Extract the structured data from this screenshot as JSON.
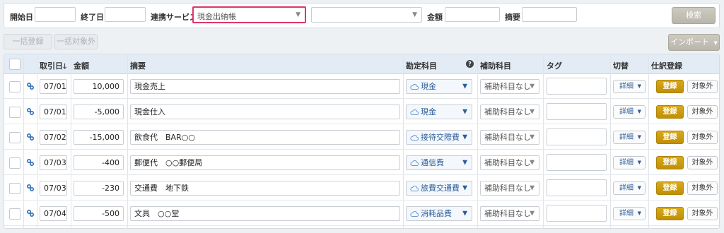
{
  "filters": {
    "start_date_label": "開始日",
    "start_date_value": "",
    "end_date_label": "終了日",
    "end_date_value": "",
    "service_label": "連携サービス",
    "service_selected": "現金出納帳",
    "service_sub_selected": "",
    "amount_label": "金額",
    "amount_value": "",
    "memo_label": "摘要",
    "memo_value": "",
    "search_button": "検索"
  },
  "actions": {
    "bulk_register": "一括登録",
    "bulk_exclude": "一括対象外",
    "import_button": "インポート"
  },
  "table": {
    "headers": {
      "date": "取引日",
      "sort_indicator": "🡓",
      "amount": "金額",
      "memo": "摘要",
      "account": "勘定科目",
      "help": "?",
      "sub_account": "補助科目",
      "tag": "タグ",
      "switch": "切替",
      "journal": "仕訳登録"
    },
    "detail_label": "詳細",
    "register_label": "登録",
    "exclude_label": "対象外",
    "rows": [
      {
        "date": "07/01",
        "amount": "10,000",
        "memo": "現金売上",
        "account": "現金",
        "sub_account": "補助科目なし",
        "tag": ""
      },
      {
        "date": "07/01",
        "amount": "-5,000",
        "memo": "現金仕入",
        "account": "現金",
        "sub_account": "補助科目なし",
        "tag": ""
      },
      {
        "date": "07/02",
        "amount": "-15,000",
        "memo": "飲食代　BAR○○",
        "account": "接待交際費",
        "sub_account": "補助科目なし",
        "tag": ""
      },
      {
        "date": "07/03",
        "amount": "-400",
        "memo": "郵便代　○○郵便局",
        "account": "通信費",
        "sub_account": "補助科目なし",
        "tag": ""
      },
      {
        "date": "07/03",
        "amount": "-230",
        "memo": "交通費　地下鉄",
        "account": "旅費交通費",
        "sub_account": "補助科目なし",
        "tag": ""
      },
      {
        "date": "07/04",
        "amount": "-500",
        "memo": "文具　○○堂",
        "account": "消耗品費",
        "sub_account": "補助科目なし",
        "tag": ""
      }
    ]
  },
  "colors": {
    "highlight_border": "#e0356b",
    "register_button": "#c99b0c",
    "account_text": "#2d5f9a",
    "header_bg": "#e3ecf5"
  }
}
